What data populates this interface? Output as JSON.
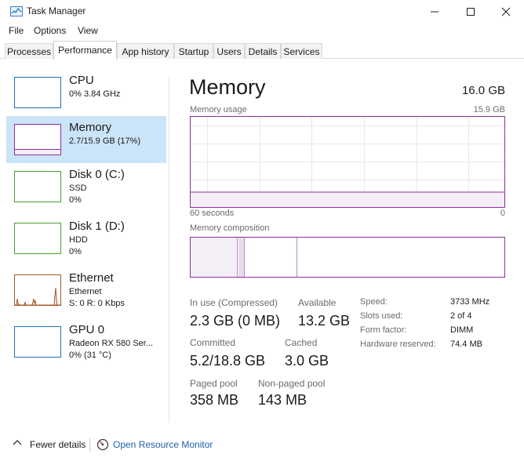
{
  "window": {
    "title": "Task Manager"
  },
  "menu": [
    "File",
    "Options",
    "View"
  ],
  "tabs": [
    {
      "label": "Processes",
      "active": false
    },
    {
      "label": "Performance",
      "active": true
    },
    {
      "label": "App history",
      "active": false
    },
    {
      "label": "Startup",
      "active": false
    },
    {
      "label": "Users",
      "active": false
    },
    {
      "label": "Details",
      "active": false
    },
    {
      "label": "Services",
      "active": false
    }
  ],
  "sidebar": {
    "items": [
      {
        "name": "CPU",
        "line1": "0% 3.84 GHz",
        "line2": "",
        "color": "#1b6fb6"
      },
      {
        "name": "Memory",
        "line1": "2.7/15.9 GB (17%)",
        "line2": "",
        "color": "#8b2f9b",
        "selected": true
      },
      {
        "name": "Disk 0 (C:)",
        "line1": "SSD",
        "line2": "0%",
        "color": "#4aa02c"
      },
      {
        "name": "Disk 1 (D:)",
        "line1": "HDD",
        "line2": "0%",
        "color": "#4aa02c"
      },
      {
        "name": "Ethernet",
        "line1": "Ethernet",
        "line2": "S: 0 R: 0 Kbps",
        "color": "#a7582b"
      },
      {
        "name": "GPU 0",
        "line1": "Radeon RX 580 Ser...",
        "line2": "0% (31 °C)",
        "color": "#1b6fb6"
      }
    ]
  },
  "main": {
    "title": "Memory",
    "total": "16.0 GB",
    "usage_label": "Memory usage",
    "usage_max": "15.9 GB",
    "time_left": "60 seconds",
    "time_right": "0",
    "composition_label": "Memory composition",
    "usage_fraction": 0.17,
    "stats": {
      "in_use_label": "In use (Compressed)",
      "in_use_value": "2.3 GB (0 MB)",
      "available_label": "Available",
      "available_value": "13.2 GB",
      "committed_label": "Committed",
      "committed_value": "5.2/18.8 GB",
      "cached_label": "Cached",
      "cached_value": "3.0 GB",
      "paged_label": "Paged pool",
      "paged_value": "358 MB",
      "nonpaged_label": "Non-paged pool",
      "nonpaged_value": "143 MB"
    },
    "specs": [
      {
        "label": "Speed:",
        "value": "3733 MHz"
      },
      {
        "label": "Slots used:",
        "value": "2 of 4"
      },
      {
        "label": "Form factor:",
        "value": "DIMM"
      },
      {
        "label": "Hardware reserved:",
        "value": "74.4 MB"
      }
    ]
  },
  "footer": {
    "fewer_details": "Fewer details",
    "open_resource_monitor": "Open Resource Monitor"
  },
  "colors": {
    "memory": "#8b2f9b",
    "selection": "#cce4f7",
    "link": "#1f5fae"
  }
}
